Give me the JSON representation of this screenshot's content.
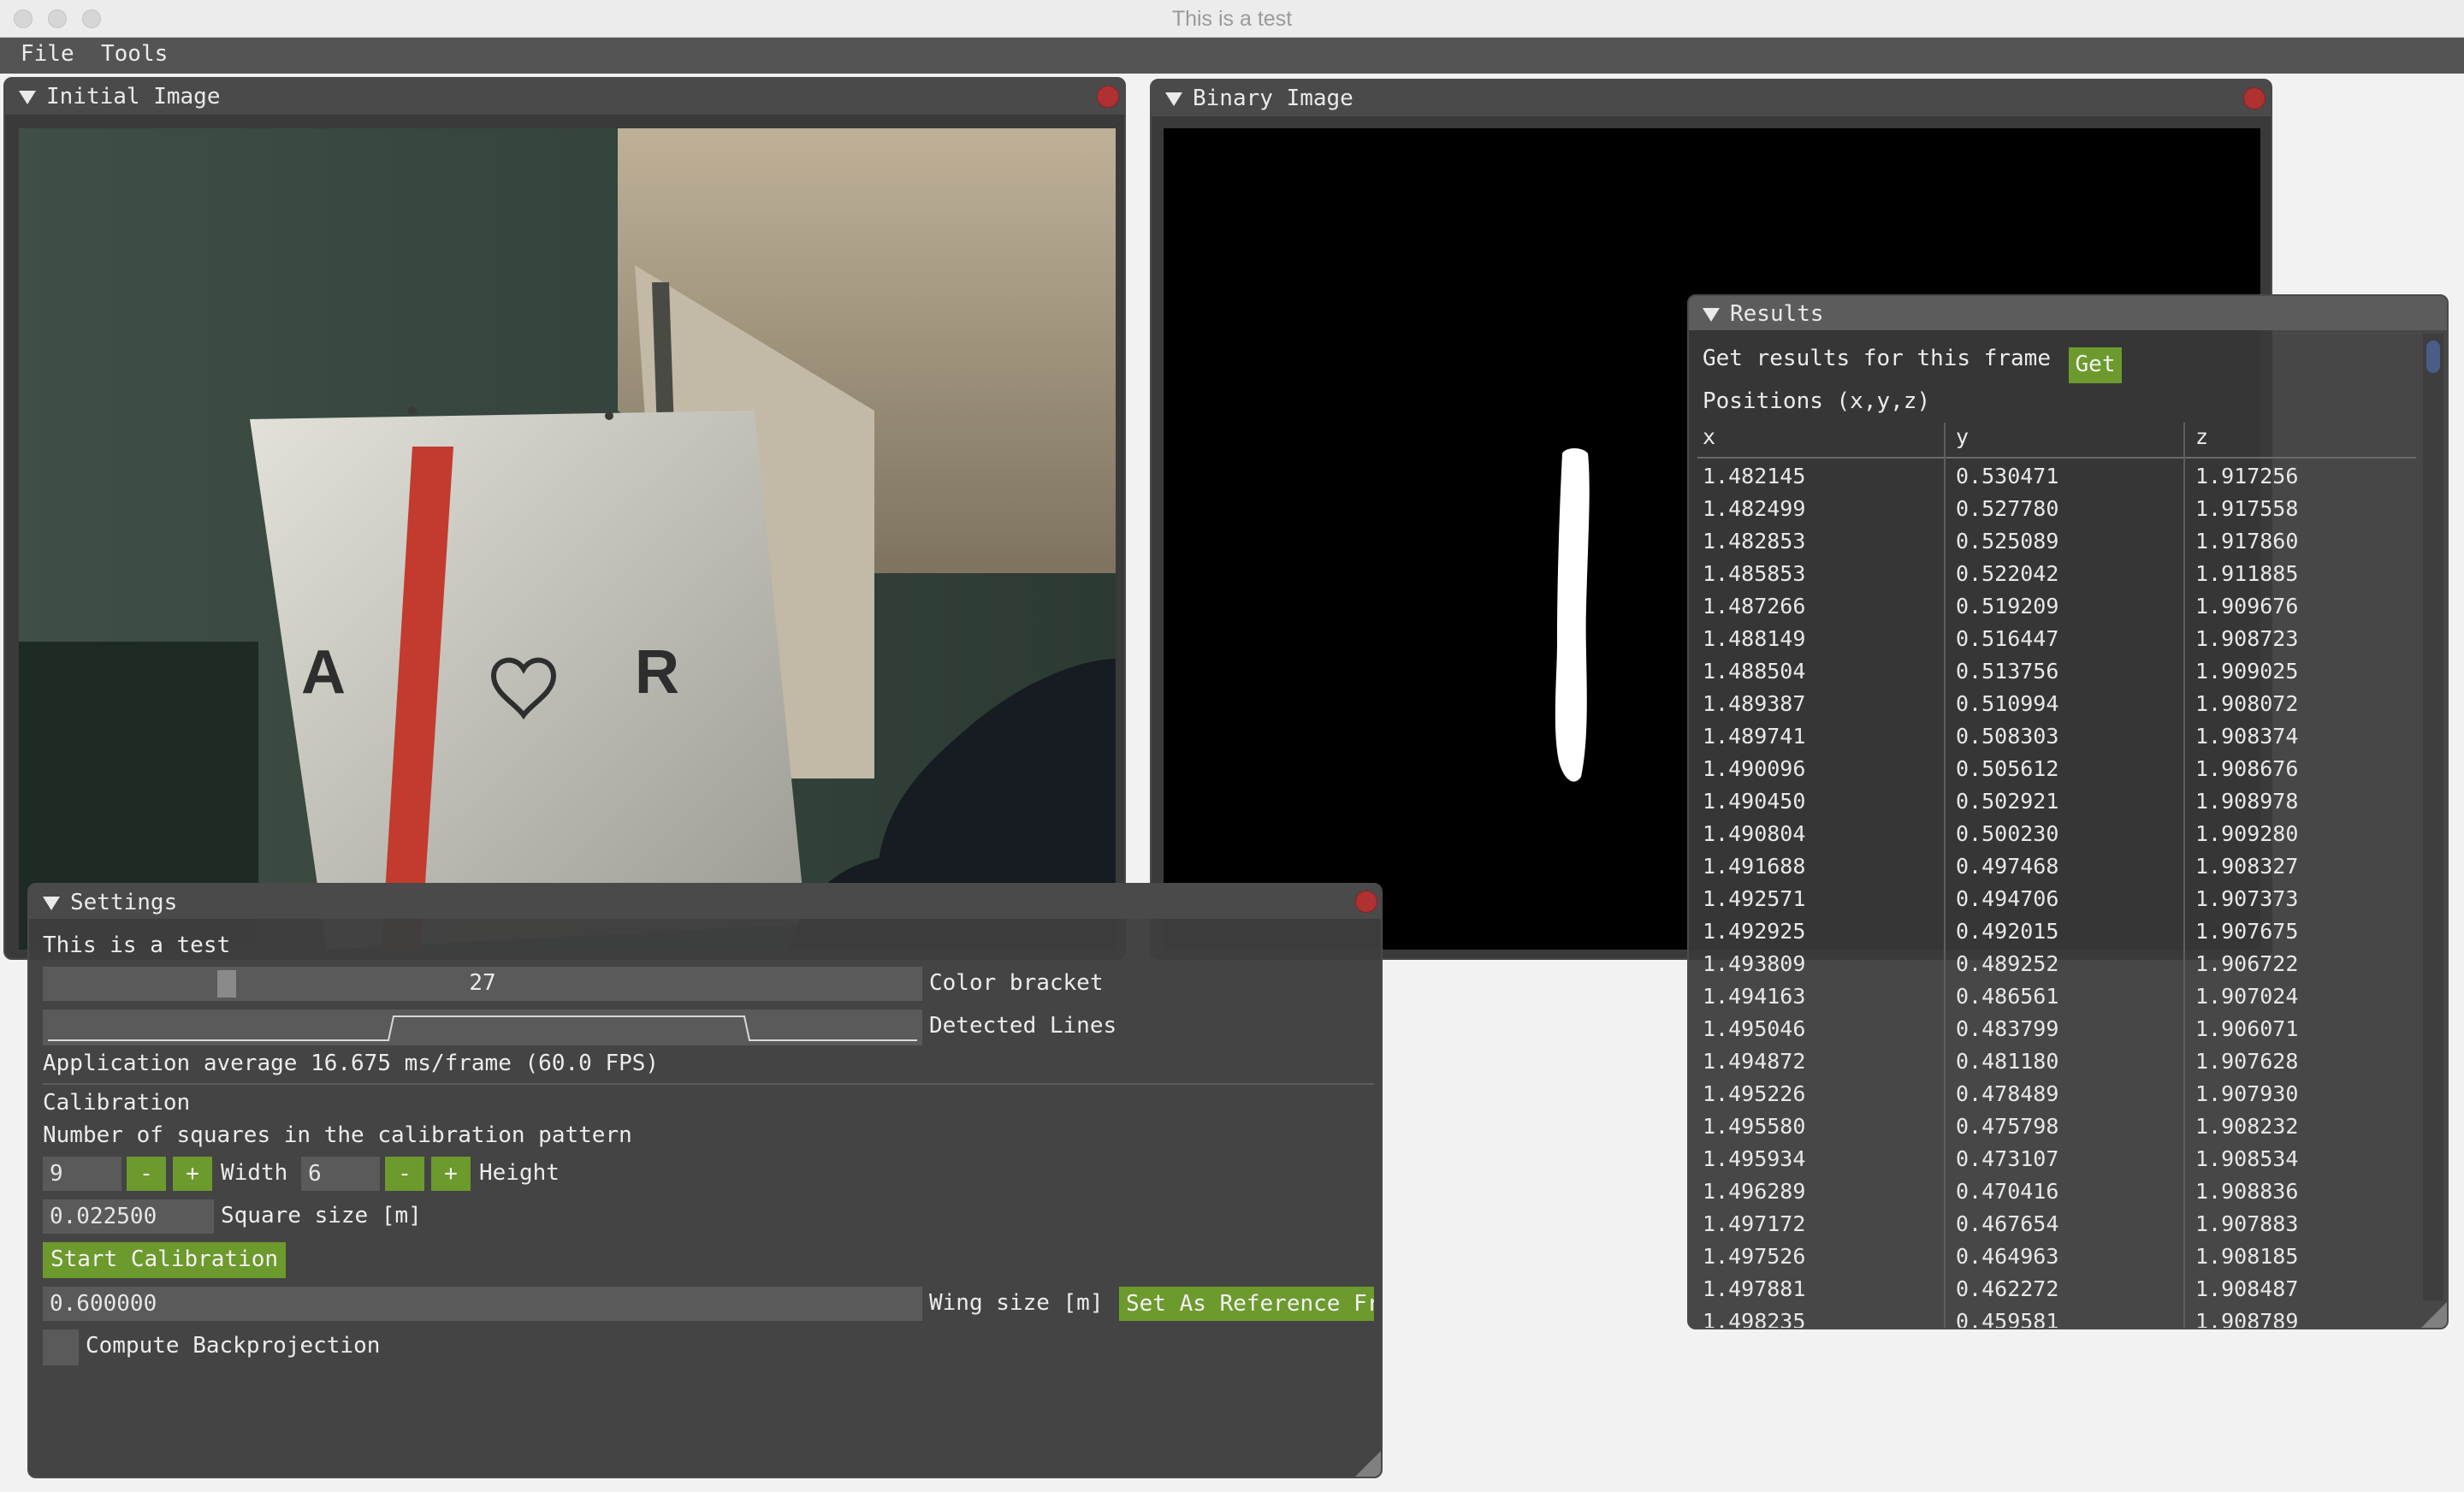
{
  "window": {
    "title": "This is a test"
  },
  "menu": [
    "File",
    "Tools"
  ],
  "initial_image": {
    "title": "Initial Image",
    "card_text_left": "A",
    "card_text_right": "R"
  },
  "binary_image": {
    "title": "Binary Image"
  },
  "settings": {
    "title": "Settings",
    "intro_text": "This is a test",
    "color_bracket_value": "27",
    "color_bracket_fraction": 0.2,
    "color_bracket_label": "Color bracket",
    "detected_lines_label": "Detected Lines",
    "app_average": "Application average 16.675 ms/frame (60.0 FPS)",
    "calibration_header": "Calibration",
    "squares_label": "Number of squares in the calibration pattern",
    "width_value": "9",
    "width_label": "Width",
    "height_value": "6",
    "height_label": "Height",
    "minus": "-",
    "plus": "+",
    "square_size_value": "0.022500",
    "square_size_label": "Square size [m]",
    "start_calibration": "Start Calibration",
    "wing_size_value": "0.600000",
    "wing_size_label": "Wing size [m]",
    "set_reference": "Set As Reference Fr",
    "compute_backprojection": "Compute Backprojection"
  },
  "results": {
    "title": "Results",
    "get_label": "Get results for this frame",
    "get_button": "Get",
    "positions_label": "Positions (x,y,z)",
    "columns": [
      "x",
      "y",
      "z"
    ],
    "rows": [
      [
        "1.482145",
        "0.530471",
        "1.917256"
      ],
      [
        "1.482499",
        "0.527780",
        "1.917558"
      ],
      [
        "1.482853",
        "0.525089",
        "1.917860"
      ],
      [
        "1.485853",
        "0.522042",
        "1.911885"
      ],
      [
        "1.487266",
        "0.519209",
        "1.909676"
      ],
      [
        "1.488149",
        "0.516447",
        "1.908723"
      ],
      [
        "1.488504",
        "0.513756",
        "1.909025"
      ],
      [
        "1.489387",
        "0.510994",
        "1.908072"
      ],
      [
        "1.489741",
        "0.508303",
        "1.908374"
      ],
      [
        "1.490096",
        "0.505612",
        "1.908676"
      ],
      [
        "1.490450",
        "0.502921",
        "1.908978"
      ],
      [
        "1.490804",
        "0.500230",
        "1.909280"
      ],
      [
        "1.491688",
        "0.497468",
        "1.908327"
      ],
      [
        "1.492571",
        "0.494706",
        "1.907373"
      ],
      [
        "1.492925",
        "0.492015",
        "1.907675"
      ],
      [
        "1.493809",
        "0.489252",
        "1.906722"
      ],
      [
        "1.494163",
        "0.486561",
        "1.907024"
      ],
      [
        "1.495046",
        "0.483799",
        "1.906071"
      ],
      [
        "1.494872",
        "0.481180",
        "1.907628"
      ],
      [
        "1.495226",
        "0.478489",
        "1.907930"
      ],
      [
        "1.495580",
        "0.475798",
        "1.908232"
      ],
      [
        "1.495934",
        "0.473107",
        "1.908534"
      ],
      [
        "1.496289",
        "0.470416",
        "1.908836"
      ],
      [
        "1.497172",
        "0.467654",
        "1.907883"
      ],
      [
        "1.497526",
        "0.464963",
        "1.908185"
      ],
      [
        "1.497881",
        "0.462272",
        "1.908487"
      ],
      [
        "1.498235",
        "0.459581",
        "1.908789"
      ]
    ]
  }
}
